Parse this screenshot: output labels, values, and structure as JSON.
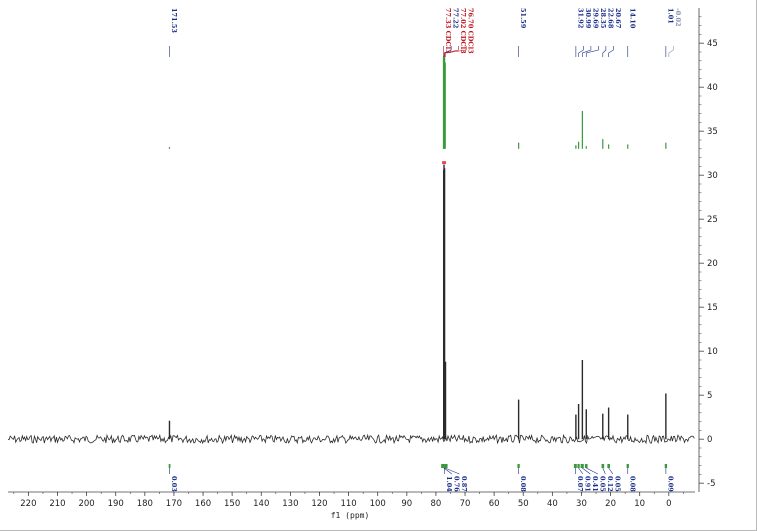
{
  "chart_data": {
    "type": "line",
    "xlabel": "f1 (ppm)",
    "xlim": [
      227,
      -9
    ],
    "ylim": [
      -6,
      49
    ],
    "x_ticks": [
      "220",
      "210",
      "200",
      "190",
      "180",
      "170",
      "160",
      "150",
      "140",
      "130",
      "120",
      "110",
      "100",
      "90",
      "80",
      "70",
      "60",
      "50",
      "40",
      "30",
      "20",
      "10",
      "0"
    ],
    "y_ticks": [
      "45",
      "40",
      "35",
      "30",
      "25",
      "20",
      "15",
      "10",
      "5",
      "0",
      "-5"
    ],
    "spectrum_peaks": [
      {
        "ppm": 171.53,
        "height": 2.1
      },
      {
        "ppm": 77.33,
        "height": 30.6
      },
      {
        "ppm": 77.22,
        "height": 31.2
      },
      {
        "ppm": 77.02,
        "height": 30.8
      },
      {
        "ppm": 76.7,
        "height": 8.8
      },
      {
        "ppm": 51.59,
        "height": 4.5
      },
      {
        "ppm": 31.92,
        "height": 2.8
      },
      {
        "ppm": 30.99,
        "height": 4.0
      },
      {
        "ppm": 29.69,
        "height": 9.0
      },
      {
        "ppm": 28.35,
        "height": 3.4
      },
      {
        "ppm": 22.68,
        "height": 2.9
      },
      {
        "ppm": 20.67,
        "height": 3.6
      },
      {
        "ppm": 14.1,
        "height": 2.8
      },
      {
        "ppm": 1.01,
        "height": 5.2
      }
    ],
    "peak_labels": [
      {
        "ppm": 171.53,
        "text": "171.53",
        "color": "#1a2f8c"
      },
      {
        "ppm": 77.33,
        "text": "77.33 CDCl3",
        "color": "#c0161e"
      },
      {
        "ppm": 77.22,
        "text": "77.22",
        "color": "#1a2f8c"
      },
      {
        "ppm": 77.02,
        "text": "77.02 CDCl3",
        "color": "#c0161e"
      },
      {
        "ppm": 76.7,
        "text": "76.70 CDCl3",
        "color": "#c0161e"
      },
      {
        "ppm": 51.59,
        "text": "51.59",
        "color": "#1a2f8c"
      },
      {
        "ppm": 31.92,
        "text": "31.92",
        "color": "#1a2f8c"
      },
      {
        "ppm": 30.99,
        "text": "30.99",
        "color": "#1a2f8c"
      },
      {
        "ppm": 29.69,
        "text": "29.69",
        "color": "#1a2f8c"
      },
      {
        "ppm": 28.35,
        "text": "28.35",
        "color": "#1a2f8c"
      },
      {
        "ppm": 22.68,
        "text": "22.68",
        "color": "#1a2f8c"
      },
      {
        "ppm": 20.67,
        "text": "20.67",
        "color": "#1a2f8c"
      },
      {
        "ppm": 14.1,
        "text": "14.10",
        "color": "#1a2f8c"
      },
      {
        "ppm": 1.01,
        "text": "1.01",
        "color": "#1a2f8c"
      },
      {
        "ppm": -0.02,
        "text": "-0.02",
        "color": "#8a8fb5"
      }
    ],
    "integrals": [
      {
        "from": 171.8,
        "to": 171.2,
        "value": "0.03"
      },
      {
        "from": 78.2,
        "to": 76.0,
        "value": "1.04"
      },
      {
        "from": 77.6,
        "to": 76.9,
        "value": "0.76"
      },
      {
        "from": 77.3,
        "to": 76.5,
        "value": "0.87"
      },
      {
        "from": 52.0,
        "to": 51.2,
        "value": "0.08"
      },
      {
        "from": 32.6,
        "to": 31.6,
        "value": "0.07"
      },
      {
        "from": 31.4,
        "to": 30.6,
        "value": "0.91"
      },
      {
        "from": 30.3,
        "to": 29.2,
        "value": "0.41"
      },
      {
        "from": 28.8,
        "to": 27.9,
        "value": "0.05"
      },
      {
        "from": 23.1,
        "to": 22.2,
        "value": "0.12"
      },
      {
        "from": 21.1,
        "to": 20.2,
        "value": "0.05"
      },
      {
        "from": 14.5,
        "to": 13.7,
        "value": "0.08"
      },
      {
        "from": 1.4,
        "to": 0.6,
        "value": "0.09"
      }
    ],
    "integral_curve_bars": [
      {
        "ppm": 171.53,
        "height": 33.2
      },
      {
        "ppm": 77.4,
        "height": 43.5
      },
      {
        "ppm": 77.2,
        "height": 43.8
      },
      {
        "ppm": 77.0,
        "height": 43.4
      },
      {
        "ppm": 76.8,
        "height": 42.8
      },
      {
        "ppm": 51.59,
        "height": 33.7
      },
      {
        "ppm": 31.92,
        "height": 33.4
      },
      {
        "ppm": 30.99,
        "height": 33.8
      },
      {
        "ppm": 29.69,
        "height": 37.3
      },
      {
        "ppm": 28.35,
        "height": 33.3
      },
      {
        "ppm": 22.68,
        "height": 34.1
      },
      {
        "ppm": 20.67,
        "height": 33.5
      },
      {
        "ppm": 14.1,
        "height": 33.5
      },
      {
        "ppm": 1.01,
        "height": 33.7
      }
    ],
    "colors": {
      "spectrum": "#2b2b2b",
      "integral": "#3a9a3a",
      "peak_blue": "#1a2f8c",
      "peak_red": "#c0161e",
      "axis": "#444444"
    }
  }
}
